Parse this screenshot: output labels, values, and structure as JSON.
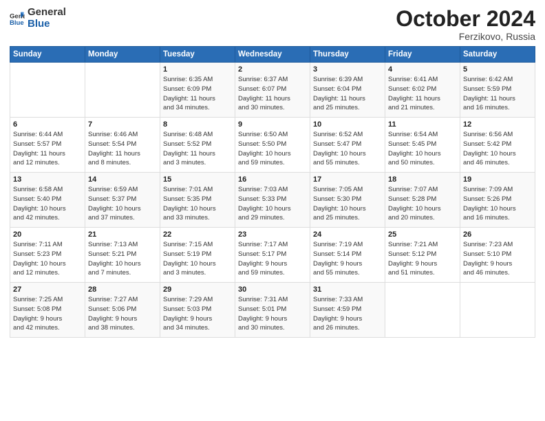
{
  "header": {
    "logo_general": "General",
    "logo_blue": "Blue",
    "month_title": "October 2024",
    "subtitle": "Ferzikovo, Russia"
  },
  "days_of_week": [
    "Sunday",
    "Monday",
    "Tuesday",
    "Wednesday",
    "Thursday",
    "Friday",
    "Saturday"
  ],
  "weeks": [
    [
      {
        "day": "",
        "content": ""
      },
      {
        "day": "",
        "content": ""
      },
      {
        "day": "1",
        "content": "Sunrise: 6:35 AM\nSunset: 6:09 PM\nDaylight: 11 hours\nand 34 minutes."
      },
      {
        "day": "2",
        "content": "Sunrise: 6:37 AM\nSunset: 6:07 PM\nDaylight: 11 hours\nand 30 minutes."
      },
      {
        "day": "3",
        "content": "Sunrise: 6:39 AM\nSunset: 6:04 PM\nDaylight: 11 hours\nand 25 minutes."
      },
      {
        "day": "4",
        "content": "Sunrise: 6:41 AM\nSunset: 6:02 PM\nDaylight: 11 hours\nand 21 minutes."
      },
      {
        "day": "5",
        "content": "Sunrise: 6:42 AM\nSunset: 5:59 PM\nDaylight: 11 hours\nand 16 minutes."
      }
    ],
    [
      {
        "day": "6",
        "content": "Sunrise: 6:44 AM\nSunset: 5:57 PM\nDaylight: 11 hours\nand 12 minutes."
      },
      {
        "day": "7",
        "content": "Sunrise: 6:46 AM\nSunset: 5:54 PM\nDaylight: 11 hours\nand 8 minutes."
      },
      {
        "day": "8",
        "content": "Sunrise: 6:48 AM\nSunset: 5:52 PM\nDaylight: 11 hours\nand 3 minutes."
      },
      {
        "day": "9",
        "content": "Sunrise: 6:50 AM\nSunset: 5:50 PM\nDaylight: 10 hours\nand 59 minutes."
      },
      {
        "day": "10",
        "content": "Sunrise: 6:52 AM\nSunset: 5:47 PM\nDaylight: 10 hours\nand 55 minutes."
      },
      {
        "day": "11",
        "content": "Sunrise: 6:54 AM\nSunset: 5:45 PM\nDaylight: 10 hours\nand 50 minutes."
      },
      {
        "day": "12",
        "content": "Sunrise: 6:56 AM\nSunset: 5:42 PM\nDaylight: 10 hours\nand 46 minutes."
      }
    ],
    [
      {
        "day": "13",
        "content": "Sunrise: 6:58 AM\nSunset: 5:40 PM\nDaylight: 10 hours\nand 42 minutes."
      },
      {
        "day": "14",
        "content": "Sunrise: 6:59 AM\nSunset: 5:37 PM\nDaylight: 10 hours\nand 37 minutes."
      },
      {
        "day": "15",
        "content": "Sunrise: 7:01 AM\nSunset: 5:35 PM\nDaylight: 10 hours\nand 33 minutes."
      },
      {
        "day": "16",
        "content": "Sunrise: 7:03 AM\nSunset: 5:33 PM\nDaylight: 10 hours\nand 29 minutes."
      },
      {
        "day": "17",
        "content": "Sunrise: 7:05 AM\nSunset: 5:30 PM\nDaylight: 10 hours\nand 25 minutes."
      },
      {
        "day": "18",
        "content": "Sunrise: 7:07 AM\nSunset: 5:28 PM\nDaylight: 10 hours\nand 20 minutes."
      },
      {
        "day": "19",
        "content": "Sunrise: 7:09 AM\nSunset: 5:26 PM\nDaylight: 10 hours\nand 16 minutes."
      }
    ],
    [
      {
        "day": "20",
        "content": "Sunrise: 7:11 AM\nSunset: 5:23 PM\nDaylight: 10 hours\nand 12 minutes."
      },
      {
        "day": "21",
        "content": "Sunrise: 7:13 AM\nSunset: 5:21 PM\nDaylight: 10 hours\nand 7 minutes."
      },
      {
        "day": "22",
        "content": "Sunrise: 7:15 AM\nSunset: 5:19 PM\nDaylight: 10 hours\nand 3 minutes."
      },
      {
        "day": "23",
        "content": "Sunrise: 7:17 AM\nSunset: 5:17 PM\nDaylight: 9 hours\nand 59 minutes."
      },
      {
        "day": "24",
        "content": "Sunrise: 7:19 AM\nSunset: 5:14 PM\nDaylight: 9 hours\nand 55 minutes."
      },
      {
        "day": "25",
        "content": "Sunrise: 7:21 AM\nSunset: 5:12 PM\nDaylight: 9 hours\nand 51 minutes."
      },
      {
        "day": "26",
        "content": "Sunrise: 7:23 AM\nSunset: 5:10 PM\nDaylight: 9 hours\nand 46 minutes."
      }
    ],
    [
      {
        "day": "27",
        "content": "Sunrise: 7:25 AM\nSunset: 5:08 PM\nDaylight: 9 hours\nand 42 minutes."
      },
      {
        "day": "28",
        "content": "Sunrise: 7:27 AM\nSunset: 5:06 PM\nDaylight: 9 hours\nand 38 minutes."
      },
      {
        "day": "29",
        "content": "Sunrise: 7:29 AM\nSunset: 5:03 PM\nDaylight: 9 hours\nand 34 minutes."
      },
      {
        "day": "30",
        "content": "Sunrise: 7:31 AM\nSunset: 5:01 PM\nDaylight: 9 hours\nand 30 minutes."
      },
      {
        "day": "31",
        "content": "Sunrise: 7:33 AM\nSunset: 4:59 PM\nDaylight: 9 hours\nand 26 minutes."
      },
      {
        "day": "",
        "content": ""
      },
      {
        "day": "",
        "content": ""
      }
    ]
  ]
}
